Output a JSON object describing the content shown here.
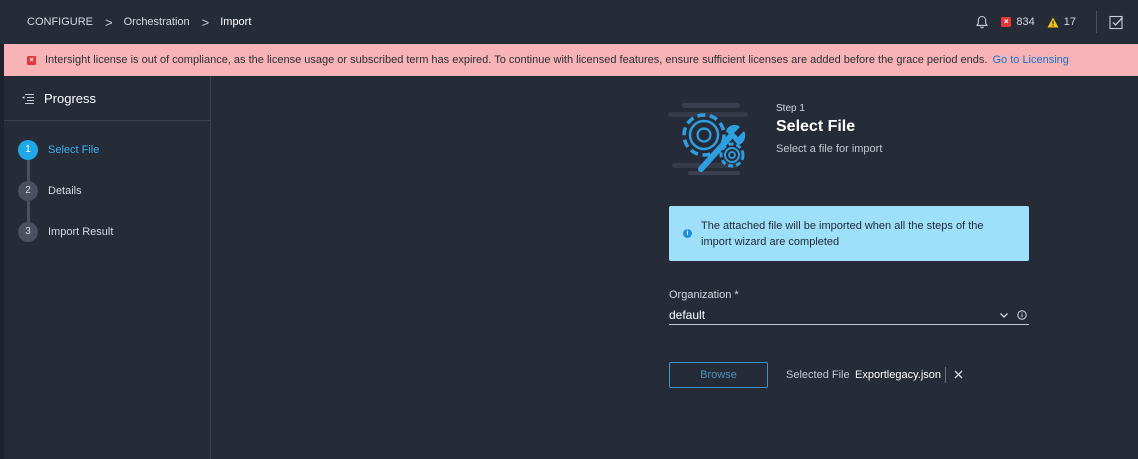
{
  "breadcrumb": {
    "items": [
      "CONFIGURE",
      "Orchestration",
      "Import"
    ],
    "separator": ">"
  },
  "header": {
    "critical_count": "834",
    "warning_count": "17",
    "critical_color": "#e2383b",
    "warning_color": "#f5c518"
  },
  "banner": {
    "message": "Intersight license is out of compliance, as the license usage or subscribed term has expired. To continue with licensed features, ensure sufficient licenses are added before the grace period ends.",
    "link_text": "Go to Licensing",
    "background_color": "#f7b3b5"
  },
  "sidebar": {
    "title": "Progress",
    "steps": [
      {
        "number": "1",
        "label": "Select File",
        "active": true
      },
      {
        "number": "2",
        "label": "Details",
        "active": false
      },
      {
        "number": "3",
        "label": "Import Result",
        "active": false
      }
    ]
  },
  "main": {
    "step_number": "Step 1",
    "title": "Select File",
    "subtitle": "Select a file for import",
    "info_message_line1": "The attached file will be imported when all the steps of the",
    "info_message_line2": "import wizard are completed",
    "organization_label": "Organization *",
    "organization_value": "default",
    "browse_label": "Browse",
    "selected_file_label": "Selected File",
    "selected_file_name": "Exportlegacy.json"
  },
  "accent_color": "#20a7e8"
}
